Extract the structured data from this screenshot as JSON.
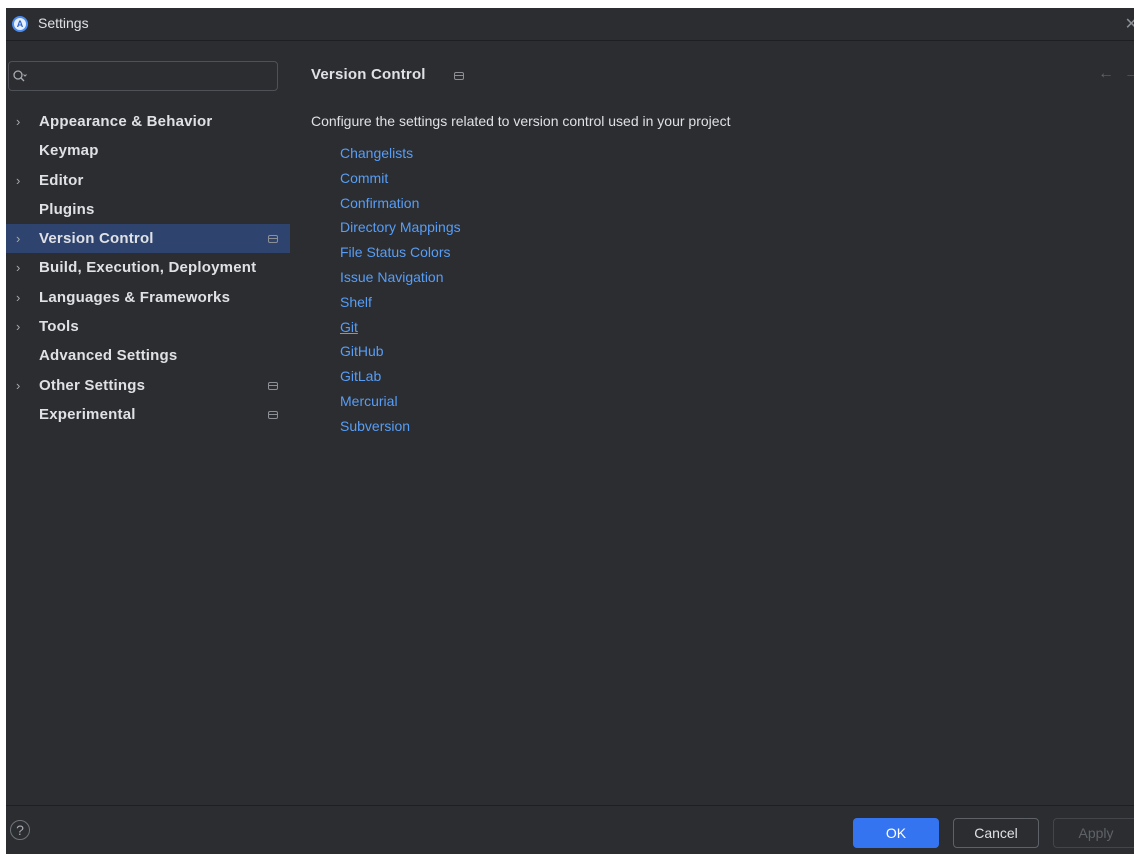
{
  "window": {
    "title": "Settings",
    "app_icon": "android-studio-icon",
    "close_glyph": "✕"
  },
  "search": {
    "value": "",
    "placeholder": ""
  },
  "sidebar": {
    "items": [
      {
        "label": "Appearance & Behavior",
        "expandable": true,
        "selected": false,
        "project_icon": false
      },
      {
        "label": "Keymap",
        "expandable": false,
        "selected": false,
        "project_icon": false
      },
      {
        "label": "Editor",
        "expandable": true,
        "selected": false,
        "project_icon": false
      },
      {
        "label": "Plugins",
        "expandable": false,
        "selected": false,
        "project_icon": false
      },
      {
        "label": "Version Control",
        "expandable": true,
        "selected": true,
        "project_icon": true
      },
      {
        "label": "Build, Execution, Deployment",
        "expandable": true,
        "selected": false,
        "project_icon": false
      },
      {
        "label": "Languages & Frameworks",
        "expandable": true,
        "selected": false,
        "project_icon": false
      },
      {
        "label": "Tools",
        "expandable": true,
        "selected": false,
        "project_icon": false
      },
      {
        "label": "Advanced Settings",
        "expandable": false,
        "selected": false,
        "project_icon": false
      },
      {
        "label": "Other Settings",
        "expandable": true,
        "selected": false,
        "project_icon": true
      },
      {
        "label": "Experimental",
        "expandable": false,
        "selected": false,
        "project_icon": true
      }
    ]
  },
  "main": {
    "title": "Version Control",
    "description": "Configure the settings related to version control used in your project",
    "links": [
      "Changelists",
      "Commit",
      "Confirmation",
      "Directory Mappings",
      "File Status Colors",
      "Issue Navigation",
      "Shelf",
      "Git",
      "GitHub",
      "GitLab",
      "Mercurial",
      "Subversion"
    ],
    "underlined_link": "Git"
  },
  "footer": {
    "help_label": "?",
    "ok_label": "OK",
    "cancel_label": "Cancel",
    "apply_label": "Apply"
  },
  "colors": {
    "background": "#2b2d30",
    "selection": "#2e436e",
    "link": "#589df6",
    "primary_button": "#3574f0"
  }
}
